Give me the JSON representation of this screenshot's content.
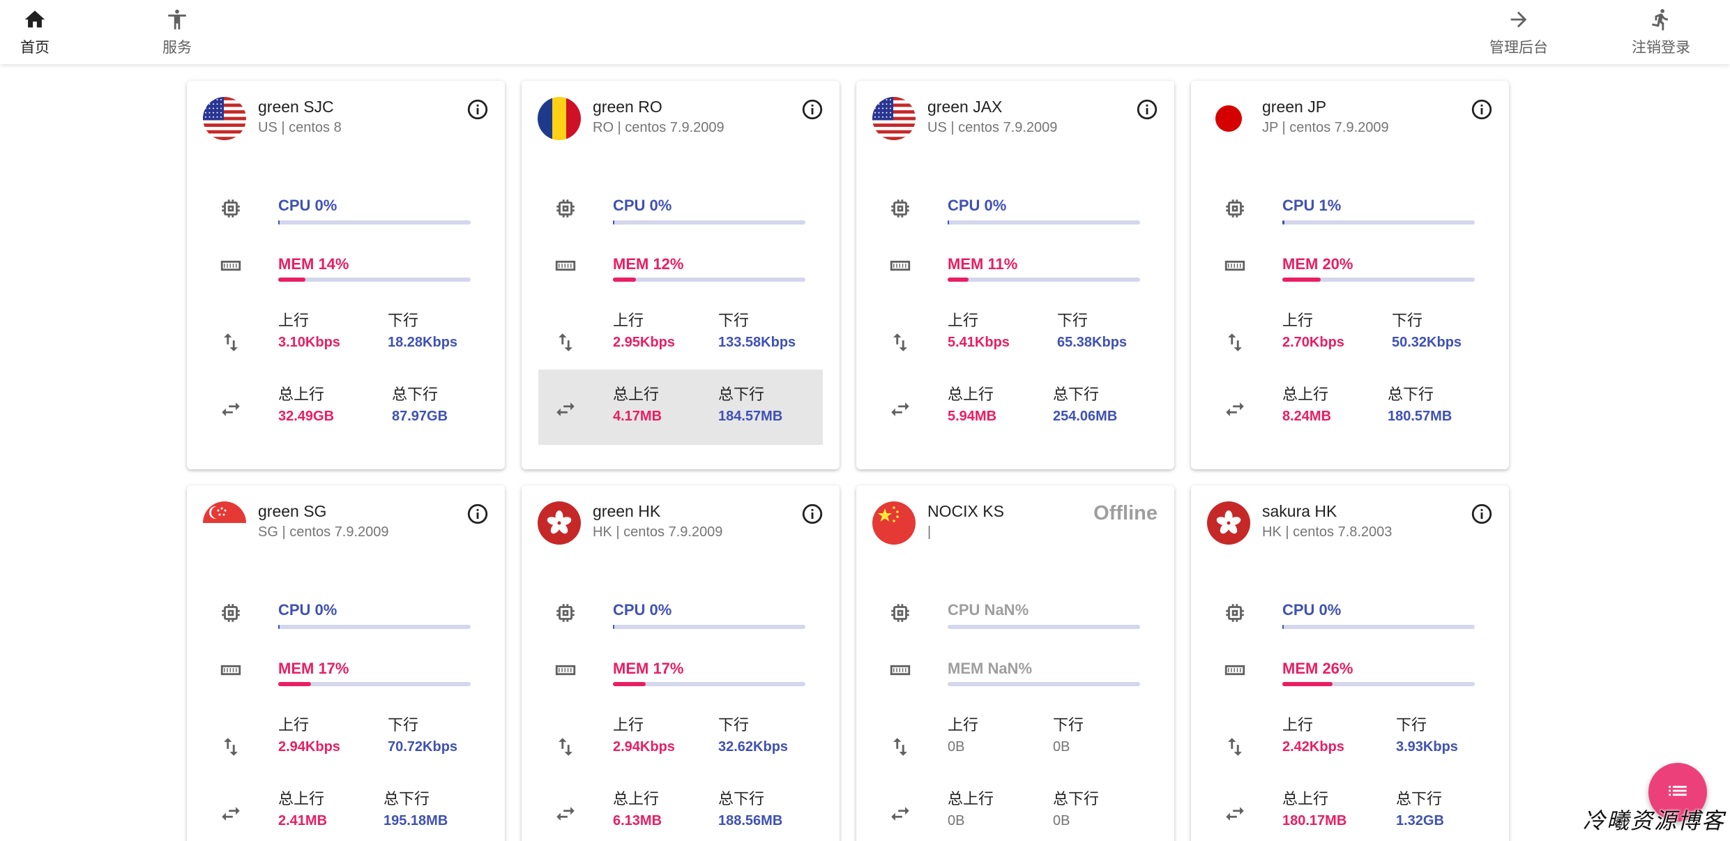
{
  "nav": {
    "home": "首页",
    "services": "服务",
    "admin": "管理后台",
    "logout": "注销登录"
  },
  "labels": {
    "up": "上行",
    "down": "下行",
    "total_up": "总上行",
    "total_down": "总下行",
    "offline": "Offline"
  },
  "colors": {
    "cpu": "#3f51b5",
    "mem": "#e91e63",
    "fab": "#ec407a"
  },
  "servers": [
    {
      "name": "green SJC",
      "sub": "US | centos 8",
      "flag": "us-flag-icon",
      "cpu_label": "CPU 0%",
      "cpu": 0,
      "mem_label": "MEM 14%",
      "mem": 14,
      "up": "3.10Kbps",
      "down": "18.28Kbps",
      "total_up": "32.49GB",
      "total_down": "87.97GB",
      "online": true
    },
    {
      "name": "green RO",
      "sub": "RO | centos 7.9.2009",
      "flag": "ro-flag-icon",
      "cpu_label": "CPU 0%",
      "cpu": 0,
      "mem_label": "MEM 12%",
      "mem": 12,
      "up": "2.95Kbps",
      "down": "133.58Kbps",
      "total_up": "4.17MB",
      "total_down": "184.57MB",
      "online": true,
      "hover": true
    },
    {
      "name": "green JAX",
      "sub": "US | centos 7.9.2009",
      "flag": "us-flag-icon",
      "cpu_label": "CPU 0%",
      "cpu": 0,
      "mem_label": "MEM 11%",
      "mem": 11,
      "up": "5.41Kbps",
      "down": "65.38Kbps",
      "total_up": "5.94MB",
      "total_down": "254.06MB",
      "online": true
    },
    {
      "name": "green JP",
      "sub": "JP | centos 7.9.2009",
      "flag": "jp-flag-icon",
      "cpu_label": "CPU 1%",
      "cpu": 1,
      "mem_label": "MEM 20%",
      "mem": 20,
      "up": "2.70Kbps",
      "down": "50.32Kbps",
      "total_up": "8.24MB",
      "total_down": "180.57MB",
      "online": true
    },
    {
      "name": "green SG",
      "sub": "SG | centos 7.9.2009",
      "flag": "sg-flag-icon",
      "cpu_label": "CPU 0%",
      "cpu": 0,
      "mem_label": "MEM 17%",
      "mem": 17,
      "up": "2.94Kbps",
      "down": "70.72Kbps",
      "total_up": "2.41MB",
      "total_down": "195.18MB",
      "online": true
    },
    {
      "name": "green HK",
      "sub": "HK | centos 7.9.2009",
      "flag": "hk-flag-icon",
      "cpu_label": "CPU 0%",
      "cpu": 0,
      "mem_label": "MEM 17%",
      "mem": 17,
      "up": "2.94Kbps",
      "down": "32.62Kbps",
      "total_up": "6.13MB",
      "total_down": "188.56MB",
      "online": true
    },
    {
      "name": "NOCIX KS",
      "sub": "|",
      "flag": "cn-flag-icon",
      "cpu_label": "CPU NaN%",
      "cpu": 0,
      "mem_label": "MEM NaN%",
      "mem": 0,
      "up": "0B",
      "down": "0B",
      "total_up": "0B",
      "total_down": "0B",
      "online": false
    },
    {
      "name": "sakura HK",
      "sub": "HK | centos 7.8.2003",
      "flag": "hk-flag-icon",
      "cpu_label": "CPU 0%",
      "cpu": 0,
      "mem_label": "MEM 26%",
      "mem": 26,
      "up": "2.42Kbps",
      "down": "3.93Kbps",
      "total_up": "180.17MB",
      "total_down": "1.32GB",
      "online": true
    }
  ],
  "watermark": "冷曦资源博客"
}
